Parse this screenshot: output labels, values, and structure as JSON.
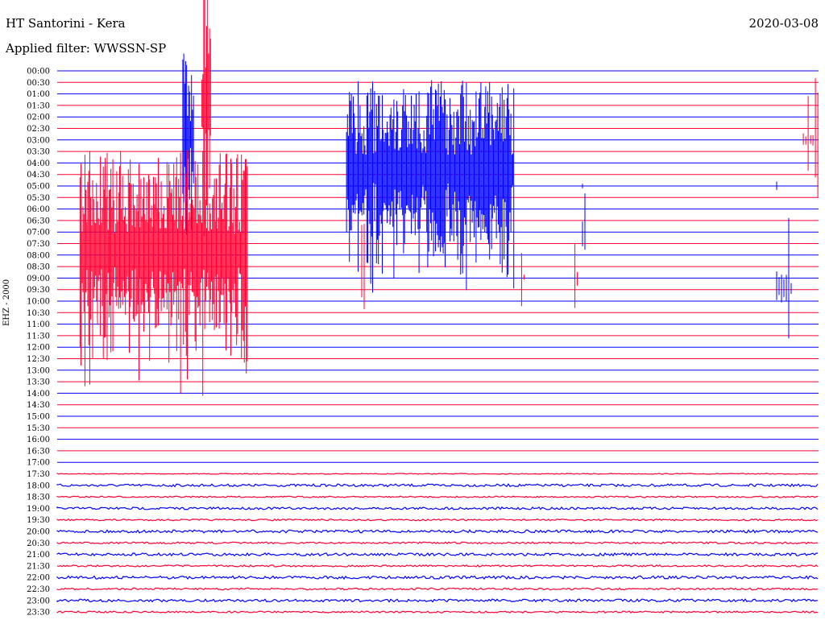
{
  "header": {
    "title": "HT Santorini - Kera",
    "date": "2020-03-08",
    "filter": "Applied filter: WWSSN-SP",
    "channel": "EHZ - 2000"
  },
  "chart_data": {
    "type": "line",
    "title": "HT Santorini - Kera",
    "ylabel": "EHZ - 2000",
    "colors": {
      "even": "#0000ff",
      "odd": "#ff0033"
    },
    "rows": [
      "00:00",
      "00:30",
      "01:00",
      "01:30",
      "02:00",
      "02:30",
      "03:00",
      "03:30",
      "04:00",
      "04:30",
      "05:00",
      "05:30",
      "06:00",
      "06:30",
      "07:00",
      "07:30",
      "08:00",
      "08:30",
      "09:00",
      "09:30",
      "10:00",
      "10:30",
      "11:00",
      "11:30",
      "12:00",
      "12:30",
      "13:00",
      "13:30",
      "14:00",
      "14:30",
      "15:00",
      "15:30",
      "16:00",
      "16:30",
      "17:00",
      "17:30",
      "18:00",
      "18:30",
      "19:00",
      "19:30",
      "20:00",
      "20:30",
      "21:00",
      "21:30",
      "22:00",
      "22:30",
      "23:00",
      "23:30"
    ],
    "noise": {
      "quiet": [
        0,
        0,
        0,
        0,
        0,
        0,
        0,
        0,
        0,
        0,
        0,
        0,
        0,
        0,
        0,
        0,
        0,
        0,
        0,
        0,
        0,
        0,
        0,
        0,
        0,
        0,
        0,
        0,
        0,
        0,
        0,
        0,
        0,
        0,
        0,
        0.5,
        1.6,
        0.9,
        1.5,
        1.0,
        1.7,
        1.1,
        1.7,
        1.1,
        1.8,
        1.2,
        1.7,
        1.1
      ]
    },
    "events": [
      {
        "row": 3,
        "x": 0.19,
        "w": 0.012,
        "amp": 150,
        "kind": "burst",
        "color": "odd"
      },
      {
        "row": 6,
        "x": 0.165,
        "w": 0.014,
        "amp": 110,
        "kind": "burst",
        "color": "even"
      },
      {
        "row": 6,
        "x": 0.98,
        "w": 0.02,
        "amp": 90,
        "kind": "spikes",
        "color": "odd"
      },
      {
        "row": 9,
        "x": 0.38,
        "w": 0.22,
        "amp": 120,
        "kind": "burst",
        "color": "even"
      },
      {
        "row": 10,
        "x": 0.945,
        "w": 0.003,
        "amp": 110,
        "kind": "spikes",
        "color": "even"
      },
      {
        "row": 10,
        "x": 0.69,
        "w": 0.003,
        "amp": 60,
        "kind": "spikes",
        "color": "even"
      },
      {
        "row": 14,
        "x": 0.69,
        "w": 0.004,
        "amp": 80,
        "kind": "spikes",
        "color": "even"
      },
      {
        "row": 16,
        "x": 0.03,
        "w": 0.22,
        "amp": 130,
        "kind": "burst",
        "color": "odd"
      },
      {
        "row": 17,
        "x": 0.4,
        "w": 0.005,
        "amp": 60,
        "kind": "spikes",
        "color": "odd"
      },
      {
        "row": 18,
        "x": 0.61,
        "w": 0.005,
        "amp": 90,
        "kind": "spikes",
        "color": "odd"
      },
      {
        "row": 18,
        "x": 0.68,
        "w": 0.004,
        "amp": 70,
        "kind": "spikes",
        "color": "odd"
      },
      {
        "row": 19,
        "x": 0.945,
        "w": 0.02,
        "amp": 120,
        "kind": "spikes",
        "color": "even"
      }
    ]
  }
}
